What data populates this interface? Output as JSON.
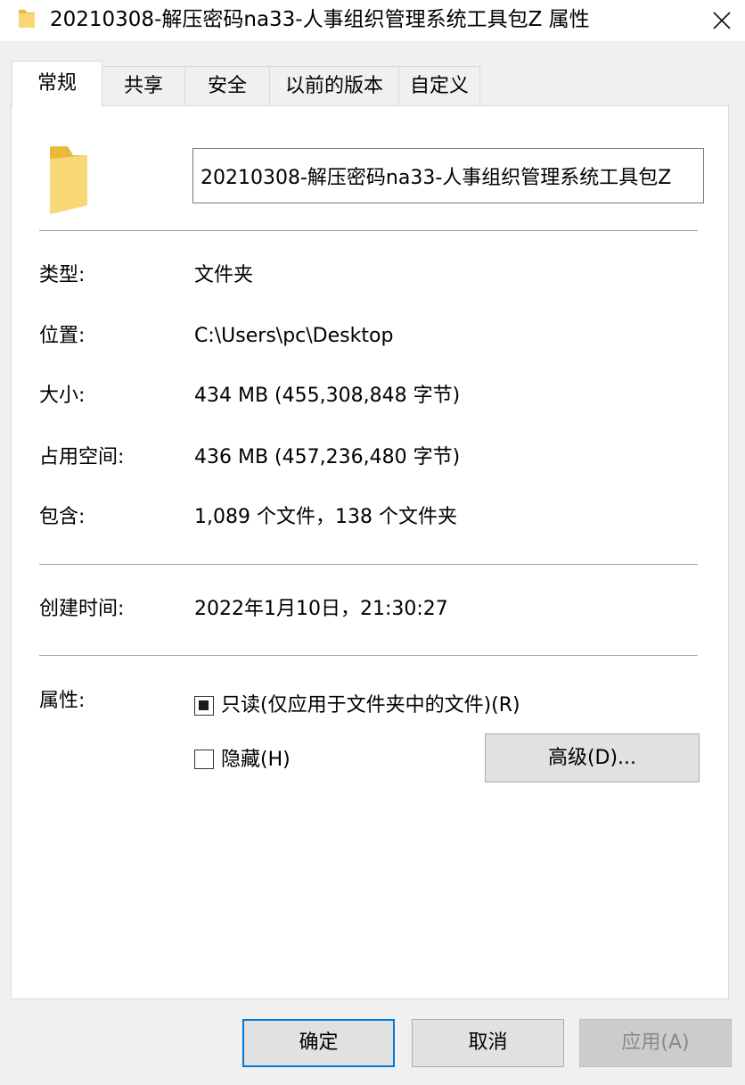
{
  "window": {
    "title": "20210308-解压密码na33-人事组织管理系统工具包Z 属性",
    "icon": "folder-icon",
    "close_icon": "close-icon"
  },
  "tabs": [
    {
      "label": "常规",
      "active": true
    },
    {
      "label": "共享",
      "active": false
    },
    {
      "label": "安全",
      "active": false
    },
    {
      "label": "以前的版本",
      "active": false
    },
    {
      "label": "自定义",
      "active": false
    }
  ],
  "general": {
    "name_value": "20210308-解压密码na33-人事组织管理系统工具包Z",
    "type_label": "类型:",
    "type_value": "文件夹",
    "location_label": "位置:",
    "location_value": "C:\\Users\\pc\\Desktop",
    "size_label": "大小:",
    "size_value": "434 MB (455,308,848 字节)",
    "size_on_disk_label": "占用空间:",
    "size_on_disk_value": "436 MB (457,236,480 字节)",
    "contains_label": "包含:",
    "contains_value": "1,089 个文件，138 个文件夹",
    "created_label": "创建时间:",
    "created_value": "2022年1月10日，21:30:27",
    "attributes_label": "属性:",
    "readonly_label": "只读(仅应用于文件夹中的文件)(R)",
    "readonly_state": "indeterminate",
    "hidden_label": "隐藏(H)",
    "hidden_checked": false,
    "advanced_button": "高级(D)..."
  },
  "footer": {
    "ok": "确定",
    "cancel": "取消",
    "apply": "应用(A)"
  },
  "colors": {
    "folder": "#f8d775",
    "folder_dark": "#e8b93a",
    "focus_border": "#0078d7"
  }
}
